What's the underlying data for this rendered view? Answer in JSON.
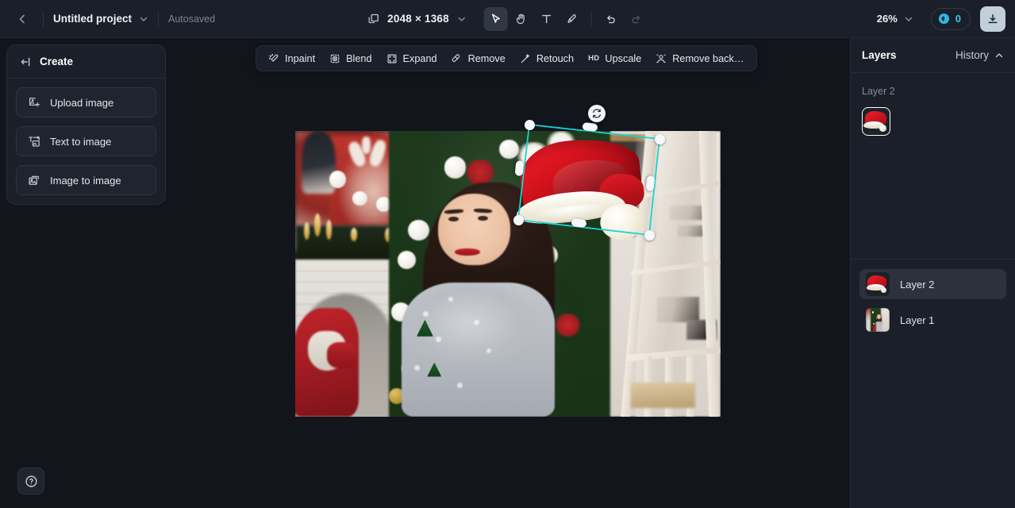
{
  "topbar": {
    "back_icon": "chevron-left-icon",
    "project_name": "Untitled project",
    "project_chevron": "chevron-down-icon",
    "autosaved": "Autosaved",
    "resize_icon": "resize-canvas-icon",
    "dimensions": "2048 × 1368",
    "dimensions_chevron": "chevron-down-icon",
    "tools": [
      {
        "name": "select-tool",
        "icon": "cursor-arrow-icon",
        "active": true,
        "disabled": false
      },
      {
        "name": "pan-tool",
        "icon": "hand-icon",
        "active": false,
        "disabled": false
      },
      {
        "name": "text-tool",
        "icon": "text-T-icon",
        "active": false,
        "disabled": false
      },
      {
        "name": "brush-tool",
        "icon": "brush-icon",
        "active": false,
        "disabled": false
      },
      {
        "name": "undo",
        "icon": "undo-arrow-icon",
        "active": false,
        "disabled": false
      },
      {
        "name": "redo",
        "icon": "redo-arrow-icon",
        "active": false,
        "disabled": true
      }
    ],
    "zoom_level": "26%",
    "zoom_chevron": "chevron-down-icon",
    "credits_icon": "credit-coin-icon",
    "credits_count": "0",
    "download_icon": "download-icon"
  },
  "create_panel": {
    "collapse_icon": "collapse-panel-icon",
    "title": "Create",
    "items": [
      {
        "label": "Upload image",
        "icon": "image-plus-icon"
      },
      {
        "label": "Text to image",
        "icon": "text-to-image-icon"
      },
      {
        "label": "Image to image",
        "icon": "image-to-image-icon"
      }
    ]
  },
  "float_toolbar": {
    "items": [
      {
        "label": "Inpaint",
        "icon": "magic-wand-icon"
      },
      {
        "label": "Blend",
        "icon": "blend-frame-icon"
      },
      {
        "label": "Expand",
        "icon": "expand-frame-icon"
      },
      {
        "label": "Remove",
        "icon": "eraser-icon"
      },
      {
        "label": "Retouch",
        "icon": "retouch-sparkle-icon"
      },
      {
        "label": "Upscale",
        "icon": "hd-badge"
      },
      {
        "label": "Remove back…",
        "icon": "remove-background-icon"
      }
    ]
  },
  "canvas": {
    "artboard_label": "christmas-portrait-artboard",
    "selection": {
      "rotate_icon": "rotate-icon",
      "accent_color": "#19d3d3",
      "handle_color": "#f5f7fa"
    }
  },
  "right_panel": {
    "tab_layers": "Layers",
    "tab_history": "History",
    "history_chevron": "chevron-up-icon",
    "preview_label": "Layer 2",
    "layers": [
      {
        "name": "Layer 2",
        "thumb": "santa-hat-thumbnail",
        "selected": true
      },
      {
        "name": "Layer 1",
        "thumb": "christmas-photo-thumbnail",
        "selected": false
      }
    ]
  },
  "help": {
    "icon": "question-circle-icon"
  }
}
